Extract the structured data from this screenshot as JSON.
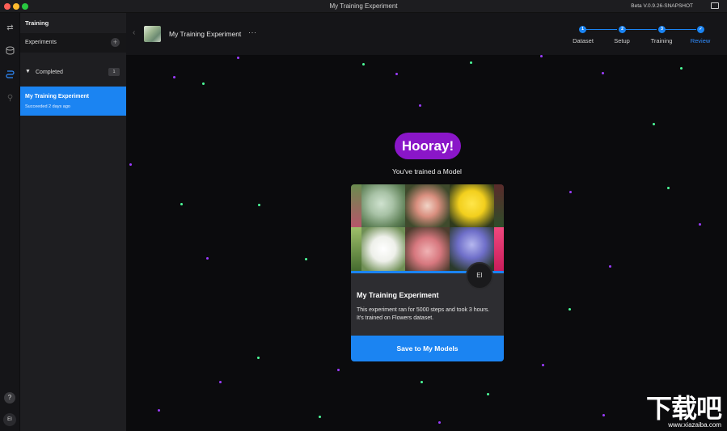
{
  "window": {
    "title": "My Training Experiment",
    "version": "Beta V.0.9.26-SNAPSHOT"
  },
  "rail": {
    "icons": [
      "switch-icon",
      "database-icon",
      "training-icon",
      "link-icon"
    ],
    "help_label": "?",
    "avatar_label": "EI"
  },
  "sidebar": {
    "title": "Training",
    "experiments_label": "Experiments",
    "add_label": "+",
    "group_label": "Completed",
    "group_count": "1",
    "item": {
      "title": "My Training Experiment",
      "subtitle": "Succeeded 2 days ago"
    }
  },
  "header": {
    "back_label": "‹",
    "experiment_title": "My Training Experiment",
    "more_label": "···",
    "steps": [
      {
        "num": "1",
        "label": "Dataset"
      },
      {
        "num": "2",
        "label": "Setup"
      },
      {
        "num": "3",
        "label": "Training"
      },
      {
        "num": "✓",
        "label": "Review"
      }
    ],
    "accent": "#1b84f2"
  },
  "main": {
    "hooray": "Hooray!",
    "subtitle": "You've trained a Model",
    "card": {
      "avatar_label": "EI",
      "title": "My Training Experiment",
      "description": "This experiment ran for 5000 steps and took 3 hours. It's trained on Flowers dataset.",
      "button": "Save to My Models"
    }
  },
  "watermark": {
    "text": "下载吧",
    "url": "www.xiazaiba.com"
  }
}
